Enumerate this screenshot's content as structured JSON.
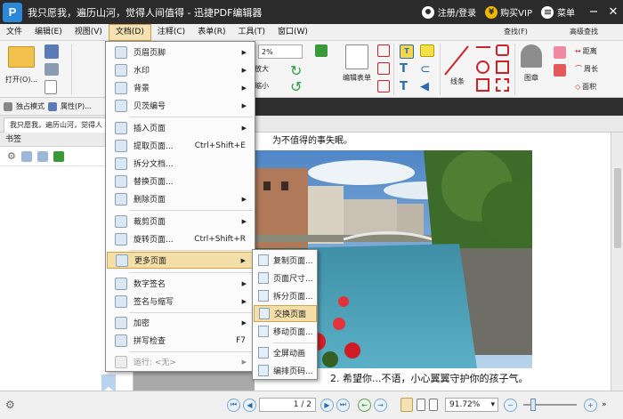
{
  "app": {
    "title": "我只愿我，遍历山河，觉得人间值得 - 迅捷PDF编辑器",
    "logo_letter": "P",
    "login_label": "注册/登录",
    "vip_label": "购买VIP",
    "menu_label": "菜单"
  },
  "menubar": [
    "文件",
    "编辑(E)",
    "视图(V)",
    "文档(D)",
    "注释(C)",
    "表单(R)",
    "工具(T)",
    "窗口(W)"
  ],
  "ribbon": {
    "open_label": "打开(O)...",
    "zoom_value": "2%",
    "zoom_in_label": "放大",
    "zoom_out_label": "缩小",
    "edit_form_label": "编辑表单",
    "lines_label": "线条",
    "stamp_label": "图章",
    "find_label": "查找(F)",
    "adv_search_label": "高级查找",
    "distance_label": "距离",
    "perimeter_label": "周长",
    "area_label": "面积"
  },
  "toolbar2": {
    "exclusive_mode": "独占模式",
    "properties": "属性(P)..."
  },
  "doc_tab": "我只愿我，遍历山河，觉得人",
  "left_panel": {
    "title": "书签"
  },
  "document": {
    "line1": "为不值得的事失眠。",
    "line2": "2. 希望你...不语，小心翼翼守护你的孩子气。"
  },
  "statusbar": {
    "page_value": "1 / 2",
    "zoom_value": "91.72%"
  },
  "dropdown": [
    {
      "label": "页眉页脚",
      "shortcut": "",
      "arrow": "▶"
    },
    {
      "label": "水印",
      "shortcut": "",
      "arrow": "▶"
    },
    {
      "label": "背景",
      "shortcut": "",
      "arrow": "▶"
    },
    {
      "label": "贝茨编号",
      "shortcut": "",
      "arrow": "▶"
    },
    {
      "label": "插入页面",
      "shortcut": "",
      "arrow": "▶"
    },
    {
      "label": "提取页面...",
      "shortcut": "Ctrl+Shift+E",
      "arrow": ""
    },
    {
      "label": "拆分文档...",
      "shortcut": "",
      "arrow": ""
    },
    {
      "label": "替换页面...",
      "shortcut": "",
      "arrow": ""
    },
    {
      "label": "删除页面",
      "shortcut": "",
      "arrow": "▶"
    },
    {
      "label": "裁剪页面",
      "shortcut": "",
      "arrow": "▶"
    },
    {
      "label": "旋转页面...",
      "shortcut": "Ctrl+Shift+R",
      "arrow": ""
    },
    {
      "label": "更多页面",
      "shortcut": "",
      "arrow": "▶"
    },
    {
      "label": "数字签名",
      "shortcut": "",
      "arrow": "▶"
    },
    {
      "label": "签名与缩写",
      "shortcut": "",
      "arrow": "▶"
    },
    {
      "label": "加密",
      "shortcut": "",
      "arrow": "▶"
    },
    {
      "label": "拼写检查",
      "shortcut": "F7",
      "arrow": ""
    },
    {
      "label": "运行: <无>",
      "shortcut": "",
      "arrow": "▶"
    }
  ],
  "submenu": [
    "复制页面...",
    "页面尺寸...",
    "拆分页面...",
    "交换页面",
    "移动页面...",
    "全屏动画",
    "编排页码..."
  ]
}
